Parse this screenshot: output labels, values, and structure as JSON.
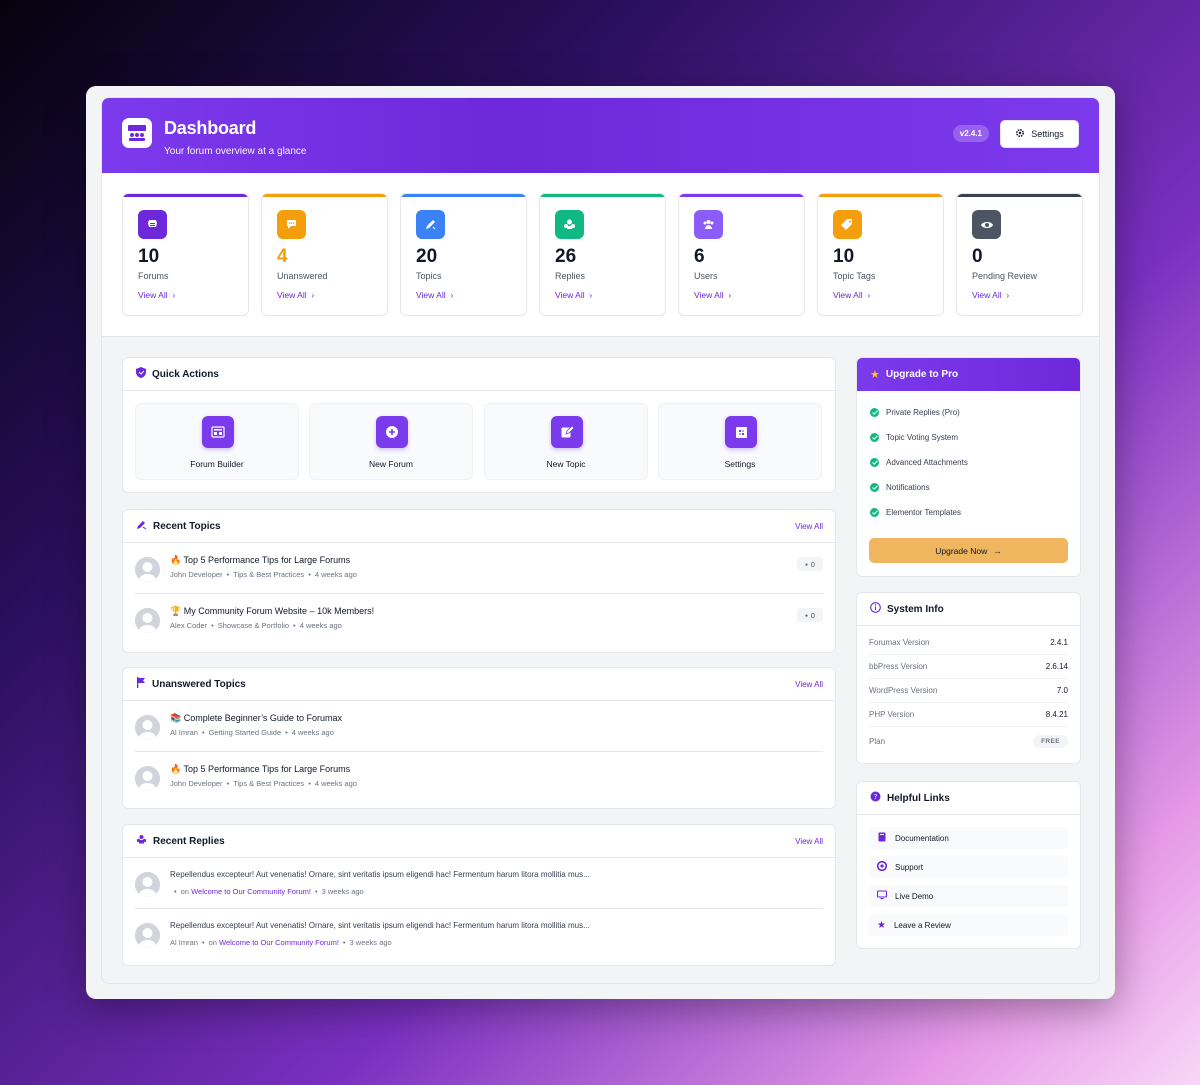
{
  "header": {
    "title": "Dashboard",
    "subtitle": "Your forum overview at a glance",
    "version": "v2.4.1",
    "settings_label": "Settings"
  },
  "stats": [
    {
      "value": "10",
      "label": "Forums",
      "link": "View All",
      "color": "#6d28d9",
      "icon": "forum-icon"
    },
    {
      "value": "4",
      "label": "Unanswered",
      "link": "View All",
      "color": "#f59e0b",
      "icon": "chat-bubble-icon"
    },
    {
      "value": "20",
      "label": "Topics",
      "link": "View All",
      "color": "#3b82f6",
      "icon": "pen-icon"
    },
    {
      "value": "26",
      "label": "Replies",
      "link": "View All",
      "color": "#10b981",
      "icon": "replies-icon"
    },
    {
      "value": "6",
      "label": "Users",
      "link": "View All",
      "color": "#7c3aed",
      "icon": "users-icon"
    },
    {
      "value": "10",
      "label": "Topic Tags",
      "link": "View All",
      "color": "#f59e0b",
      "icon": "tag-icon"
    },
    {
      "value": "0",
      "label": "Pending Review",
      "link": "View All",
      "color": "#4b5563",
      "icon": "eye-icon"
    }
  ],
  "quick_actions": {
    "title": "Quick Actions",
    "items": [
      {
        "label": "Forum Builder",
        "icon": "builder-icon"
      },
      {
        "label": "New Forum",
        "icon": "plus-circle-icon"
      },
      {
        "label": "New Topic",
        "icon": "edit-icon"
      },
      {
        "label": "Settings",
        "icon": "settings-icon"
      }
    ]
  },
  "recent_topics": {
    "title": "Recent Topics",
    "view_all": "View All",
    "items": [
      {
        "title": "🔥 Top 5 Performance Tips for Large Forums",
        "author": "John Developer",
        "forum": "Tips & Best Practices",
        "time": "4 weeks ago",
        "count": "0"
      },
      {
        "title": "🏆 My Community Forum Website – 10k Members!",
        "author": "Alex Coder",
        "forum": "Showcase & Portfolio",
        "time": "4 weeks ago",
        "count": "0"
      }
    ]
  },
  "unanswered_topics": {
    "title": "Unanswered Topics",
    "view_all": "View All",
    "items": [
      {
        "title": "📚 Complete Beginner’s Guide to Forumax",
        "author": "Al Imran",
        "forum": "Getting Started Guide",
        "time": "4 weeks ago"
      },
      {
        "title": "🔥 Top 5 Performance Tips for Large Forums",
        "author": "John Developer",
        "forum": "Tips & Best Practices",
        "time": "4 weeks ago"
      }
    ]
  },
  "recent_replies": {
    "title": "Recent Replies",
    "view_all": "View All",
    "items": [
      {
        "text": "Repellendus excepteur! Aut venenatis! Ornare, sint veritatis ipsum eligendi hac! Fermentum harum litora mollitia mus...",
        "author": "",
        "on": "on",
        "topic": "Welcome to Our Community Forum!",
        "time": "3 weeks ago"
      },
      {
        "text": "Repellendus excepteur! Aut venenatis! Ornare, sint veritatis ipsum eligendi hac! Fermentum harum litora mollitia mus...",
        "author": "Al Imran",
        "on": "on",
        "topic": "Welcome to Our Community Forum!",
        "time": "3 weeks ago"
      }
    ]
  },
  "upgrade": {
    "title": "Upgrade to Pro",
    "features": [
      "Private Replies (Pro)",
      "Topic Voting System",
      "Advanced Attachments",
      "Notifications",
      "Elementor Templates"
    ],
    "button": "Upgrade Now"
  },
  "system_info": {
    "title": "System Info",
    "rows": [
      {
        "label": "Forumax Version",
        "value": "2.4.1"
      },
      {
        "label": "bbPress Version",
        "value": "2.6.14"
      },
      {
        "label": "WordPress Version",
        "value": "7.0"
      },
      {
        "label": "PHP Version",
        "value": "8.4.21"
      },
      {
        "label": "Plan",
        "value": "FREE"
      }
    ]
  },
  "helpful_links": {
    "title": "Helpful Links",
    "items": [
      {
        "label": "Documentation",
        "icon": "book-icon"
      },
      {
        "label": "Support",
        "icon": "lifebuoy-icon"
      },
      {
        "label": "Live Demo",
        "icon": "monitor-icon"
      },
      {
        "label": "Leave a Review",
        "icon": "star-icon"
      }
    ]
  }
}
